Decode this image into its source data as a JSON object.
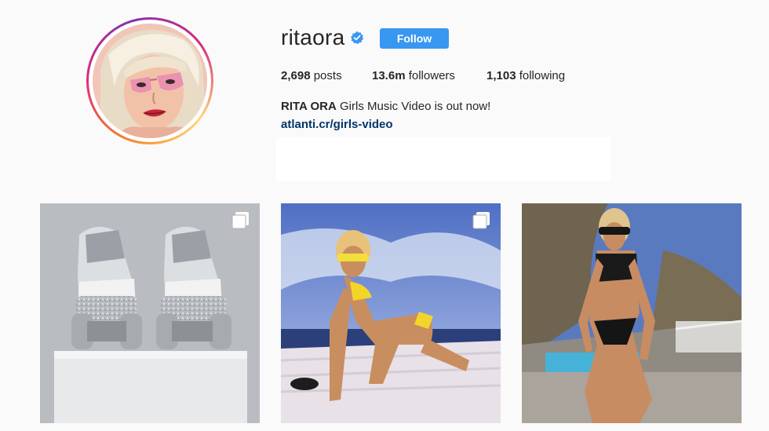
{
  "profile": {
    "username": "ritaora",
    "verified_icon": "verified-badge-icon",
    "follow_label": "Follow",
    "avatar_icon": "profile-avatar"
  },
  "stats": {
    "posts_count": "2,698",
    "posts_label": "posts",
    "followers_count": "13.6m",
    "followers_label": "followers",
    "following_count": "1,103",
    "following_label": "following"
  },
  "bio": {
    "name": "RITA ORA",
    "text": " Girls Music Video is out now!",
    "link": "atlanti.cr/girls-video"
  },
  "posts": [
    {
      "kind": "photo",
      "description_icon": "roller-skates-photo",
      "multi_icon": "carousel-icon"
    },
    {
      "kind": "photo",
      "description_icon": "boat-deck-photo",
      "multi_icon": "carousel-icon"
    },
    {
      "kind": "photo",
      "description_icon": "swimsuit-photo"
    }
  ],
  "colors": {
    "follow_button": "#3897f0",
    "link": "#003569",
    "verified": "#3897f0",
    "background": "#fafafa"
  }
}
